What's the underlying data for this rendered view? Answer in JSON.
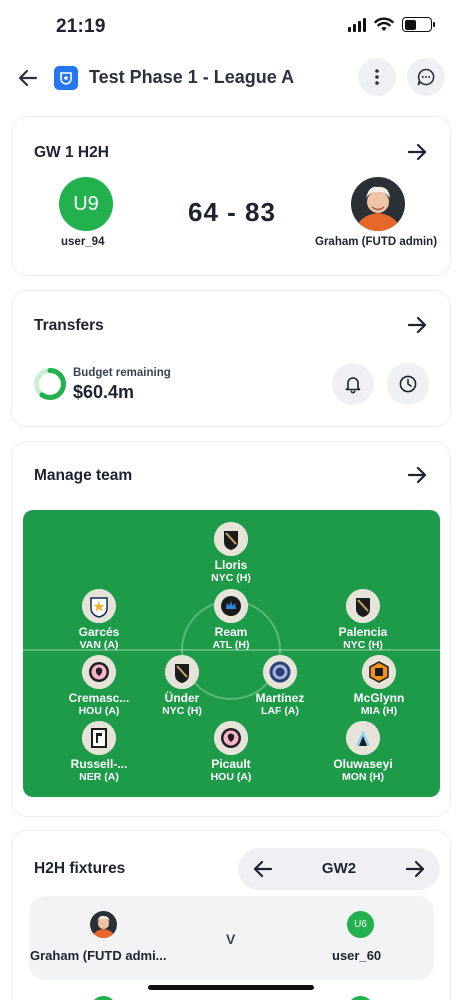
{
  "status_bar": {
    "time": "21:19"
  },
  "header": {
    "title": "Test Phase 1 - League A"
  },
  "h2h": {
    "title": "GW 1 H2H",
    "home": {
      "initials": "U9",
      "name": "user_94"
    },
    "score": "64 - 83",
    "away": {
      "name": "Graham (FUTD admin)"
    }
  },
  "transfers": {
    "title": "Transfers",
    "budget_label": "Budget remaining",
    "budget_value": "$60.4m",
    "budget_fraction": 0.6
  },
  "team": {
    "title": "Manage team",
    "players": [
      {
        "name": "Lloris",
        "fixture": "NYC (H)",
        "badge": "lafc-icon"
      },
      {
        "name": "Garcés",
        "fixture": "VAN (A)",
        "badge": "galaxy-icon"
      },
      {
        "name": "Ream",
        "fixture": "ATL (H)",
        "badge": "charlotte-icon"
      },
      {
        "name": "Palencia",
        "fixture": "NYC (H)",
        "badge": "lafc-icon"
      },
      {
        "name": "Cremasc...",
        "fixture": "HOU (A)",
        "badge": "miami-icon"
      },
      {
        "name": "Ünder",
        "fixture": "NYC (H)",
        "badge": "lafc-icon"
      },
      {
        "name": "Martínez",
        "fixture": "LAF (A)",
        "badge": "atlanta-icon"
      },
      {
        "name": "McGlynn",
        "fixture": "MIA (H)",
        "badge": "houston-icon"
      },
      {
        "name": "Russell-...",
        "fixture": "NER (A)",
        "badge": "columbus-icon"
      },
      {
        "name": "Picault",
        "fixture": "HOU (A)",
        "badge": "miami-icon"
      },
      {
        "name": "Oluwaseyi",
        "fixture": "MON (H)",
        "badge": "minnesota-icon"
      }
    ]
  },
  "fixtures": {
    "title": "H2H fixtures",
    "gameweek": "GW2",
    "match": {
      "home_name": "Graham (FUTD admi...",
      "vs": "V",
      "away_initials": "U6",
      "away_name": "user_60"
    }
  },
  "colors": {
    "accent_green": "#1e9b48",
    "avatar_green": "#23b14d",
    "league_blue": "#2477f0"
  }
}
